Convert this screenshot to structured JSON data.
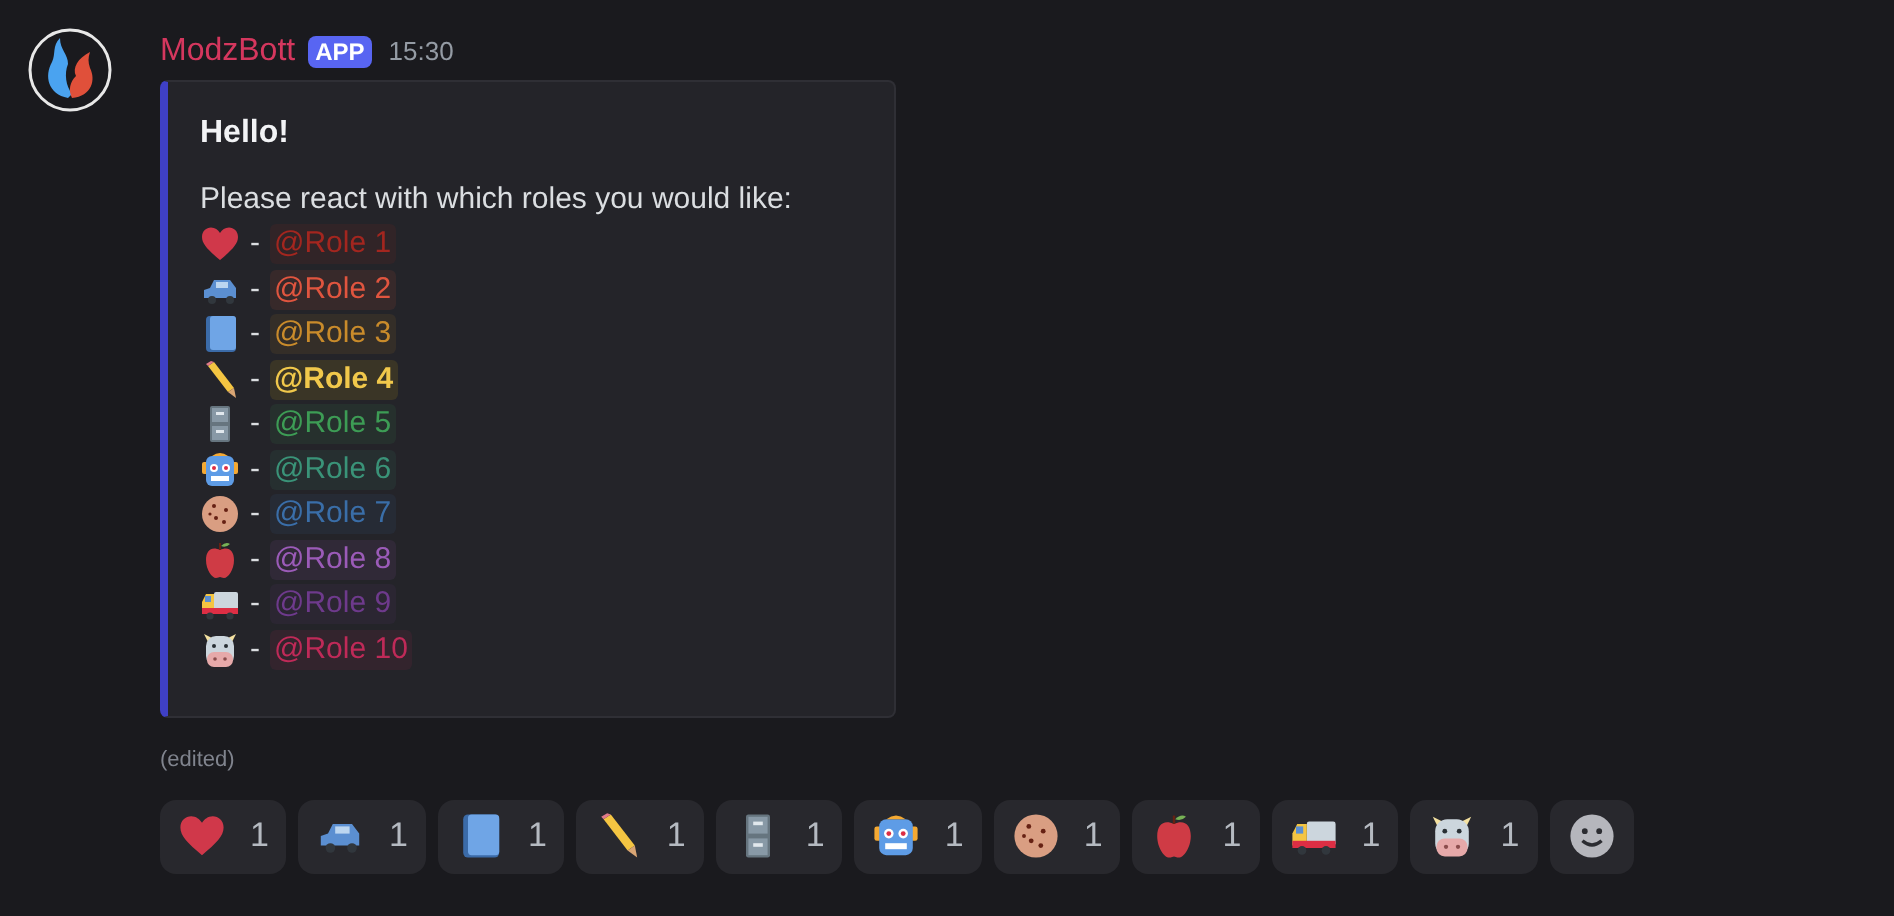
{
  "message": {
    "author": "ModzBott",
    "badge": "APP",
    "time": "15:30",
    "edited": "(edited)"
  },
  "embed": {
    "title": "Hello!",
    "description": "Please react with which roles you would like:",
    "separator": "-",
    "roles": [
      {
        "kind": "heart",
        "mention": "@Role 1",
        "color": "#a3261f",
        "emphasized": false
      },
      {
        "kind": "car",
        "mention": "@Role 2",
        "color": "#e0553f",
        "emphasized": false
      },
      {
        "kind": "book",
        "mention": "@Role 3",
        "color": "#c98b2b",
        "emphasized": false
      },
      {
        "kind": "pencil",
        "mention": "@Role 4",
        "color": "#f1c84b",
        "emphasized": true
      },
      {
        "kind": "cabinet",
        "mention": "@Role 5",
        "color": "#3d9c55",
        "emphasized": false
      },
      {
        "kind": "robot",
        "mention": "@Role 6",
        "color": "#3a9378",
        "emphasized": false
      },
      {
        "kind": "cookie",
        "mention": "@Role 7",
        "color": "#3a6ea8",
        "emphasized": false
      },
      {
        "kind": "apple",
        "mention": "@Role 8",
        "color": "#9b5bb8",
        "emphasized": false
      },
      {
        "kind": "truck",
        "mention": "@Role 9",
        "color": "#6e3a8c",
        "emphasized": false
      },
      {
        "kind": "cow",
        "mention": "@Role 10",
        "color": "#bf2a58",
        "emphasized": false
      }
    ]
  },
  "reactions": [
    {
      "kind": "heart",
      "count": "1"
    },
    {
      "kind": "car",
      "count": "1"
    },
    {
      "kind": "book",
      "count": "1"
    },
    {
      "kind": "pencil",
      "count": "1"
    },
    {
      "kind": "cabinet",
      "count": "1"
    },
    {
      "kind": "robot",
      "count": "1"
    },
    {
      "kind": "cookie",
      "count": "1"
    },
    {
      "kind": "apple",
      "count": "1"
    },
    {
      "kind": "truck",
      "count": "1"
    },
    {
      "kind": "cow",
      "count": "1"
    },
    {
      "kind": "add"
    }
  ]
}
